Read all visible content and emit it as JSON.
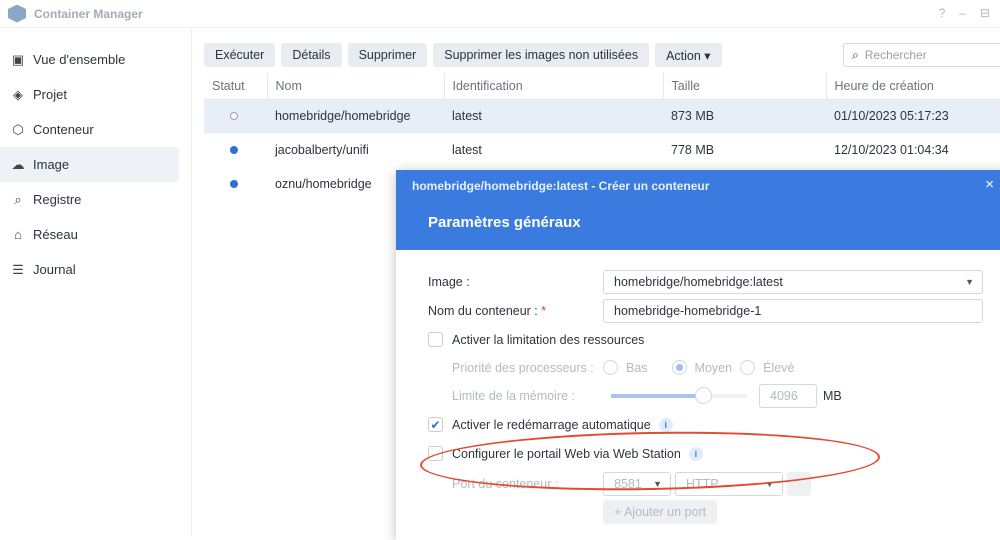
{
  "app": {
    "title": "Container Manager",
    "controls": [
      "?",
      "–",
      "⊟"
    ]
  },
  "sidebar": {
    "items": [
      {
        "label": "Vue d'ensemble",
        "icon": "▣"
      },
      {
        "label": "Projet",
        "icon": "◈"
      },
      {
        "label": "Conteneur",
        "icon": "⬡"
      },
      {
        "label": "Image",
        "icon": "☁"
      },
      {
        "label": "Registre",
        "icon": "⌕"
      },
      {
        "label": "Réseau",
        "icon": "⌂"
      },
      {
        "label": "Journal",
        "icon": "☰"
      }
    ]
  },
  "toolbar": {
    "run": "Exécuter",
    "details": "Détails",
    "delete": "Supprimer",
    "prune": "Supprimer les images non utilisées",
    "action": "Action ▾",
    "search_placeholder": "Rechercher"
  },
  "table": {
    "headers": [
      "Statut",
      "Nom",
      "Identification",
      "Taille",
      "Heure de création"
    ],
    "rows": [
      {
        "name": "homebridge/homebridge",
        "tag": "latest",
        "size": "873 MB",
        "created": "01/10/2023 05:17:23"
      },
      {
        "name": "jacobalberty/unifi",
        "tag": "latest",
        "size": "778 MB",
        "created": "12/10/2023 01:04:34"
      },
      {
        "name": "oznu/homebridge",
        "tag": "",
        "size": "",
        "created": ""
      }
    ]
  },
  "dialog": {
    "title": "homebridge/homebridge:latest - Créer un conteneur",
    "close": "×",
    "section": "Paramètres généraux",
    "image_label": "Image :",
    "image_value": "homebridge/homebridge:latest",
    "name_label": "Nom du conteneur :",
    "required": "*",
    "name_value": "homebridge-homebridge-1",
    "limit_label": "Activer la limitation des ressources",
    "cpu_label": "Priorité des processeurs :",
    "cpu_options": [
      "Bas",
      "Moyen",
      "Élevé"
    ],
    "mem_label": "Limite de la mémoire :",
    "mem_value": "4096",
    "mem_unit": "MB",
    "mem_fraction": 0.68,
    "restart_label": "Activer le redémarrage automatique",
    "webstation_label": "Configurer le portail Web via Web Station",
    "port_label": "Port du conteneur :",
    "port_value": "8581",
    "protocol_value": "HTTP",
    "add_port": "+ Ajouter un port",
    "info": "i"
  }
}
